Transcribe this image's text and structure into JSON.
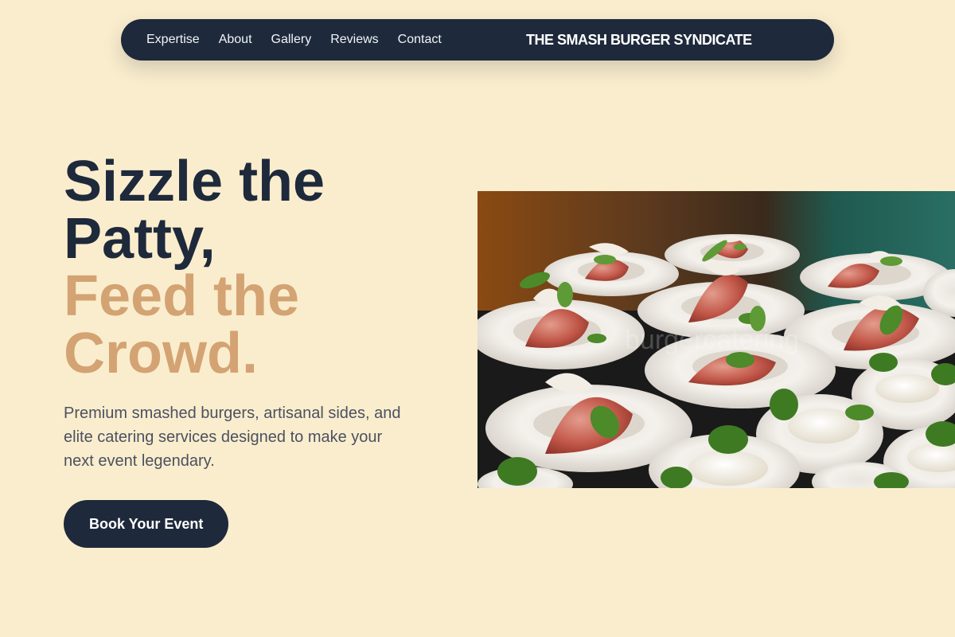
{
  "nav": {
    "links": [
      "Expertise",
      "About",
      "Gallery",
      "Reviews",
      "Contact"
    ],
    "brand": "THE SMASH BURGER SYNDICATE"
  },
  "hero": {
    "title_line_1": "Sizzle the",
    "title_line_2": "Patty,",
    "title_line_3": "Feed the",
    "title_line_4": "Crowd.",
    "subtitle": "Premium smashed burgers, artisanal sides, and elite catering services designed to make your next event legendary.",
    "cta_label": "Book Your Event"
  },
  "image": {
    "watermark": "burgercatering",
    "subject": "catering platters"
  },
  "colors": {
    "background": "#FAEDCD",
    "navy": "#1E293B",
    "accent": "#D4A373"
  }
}
